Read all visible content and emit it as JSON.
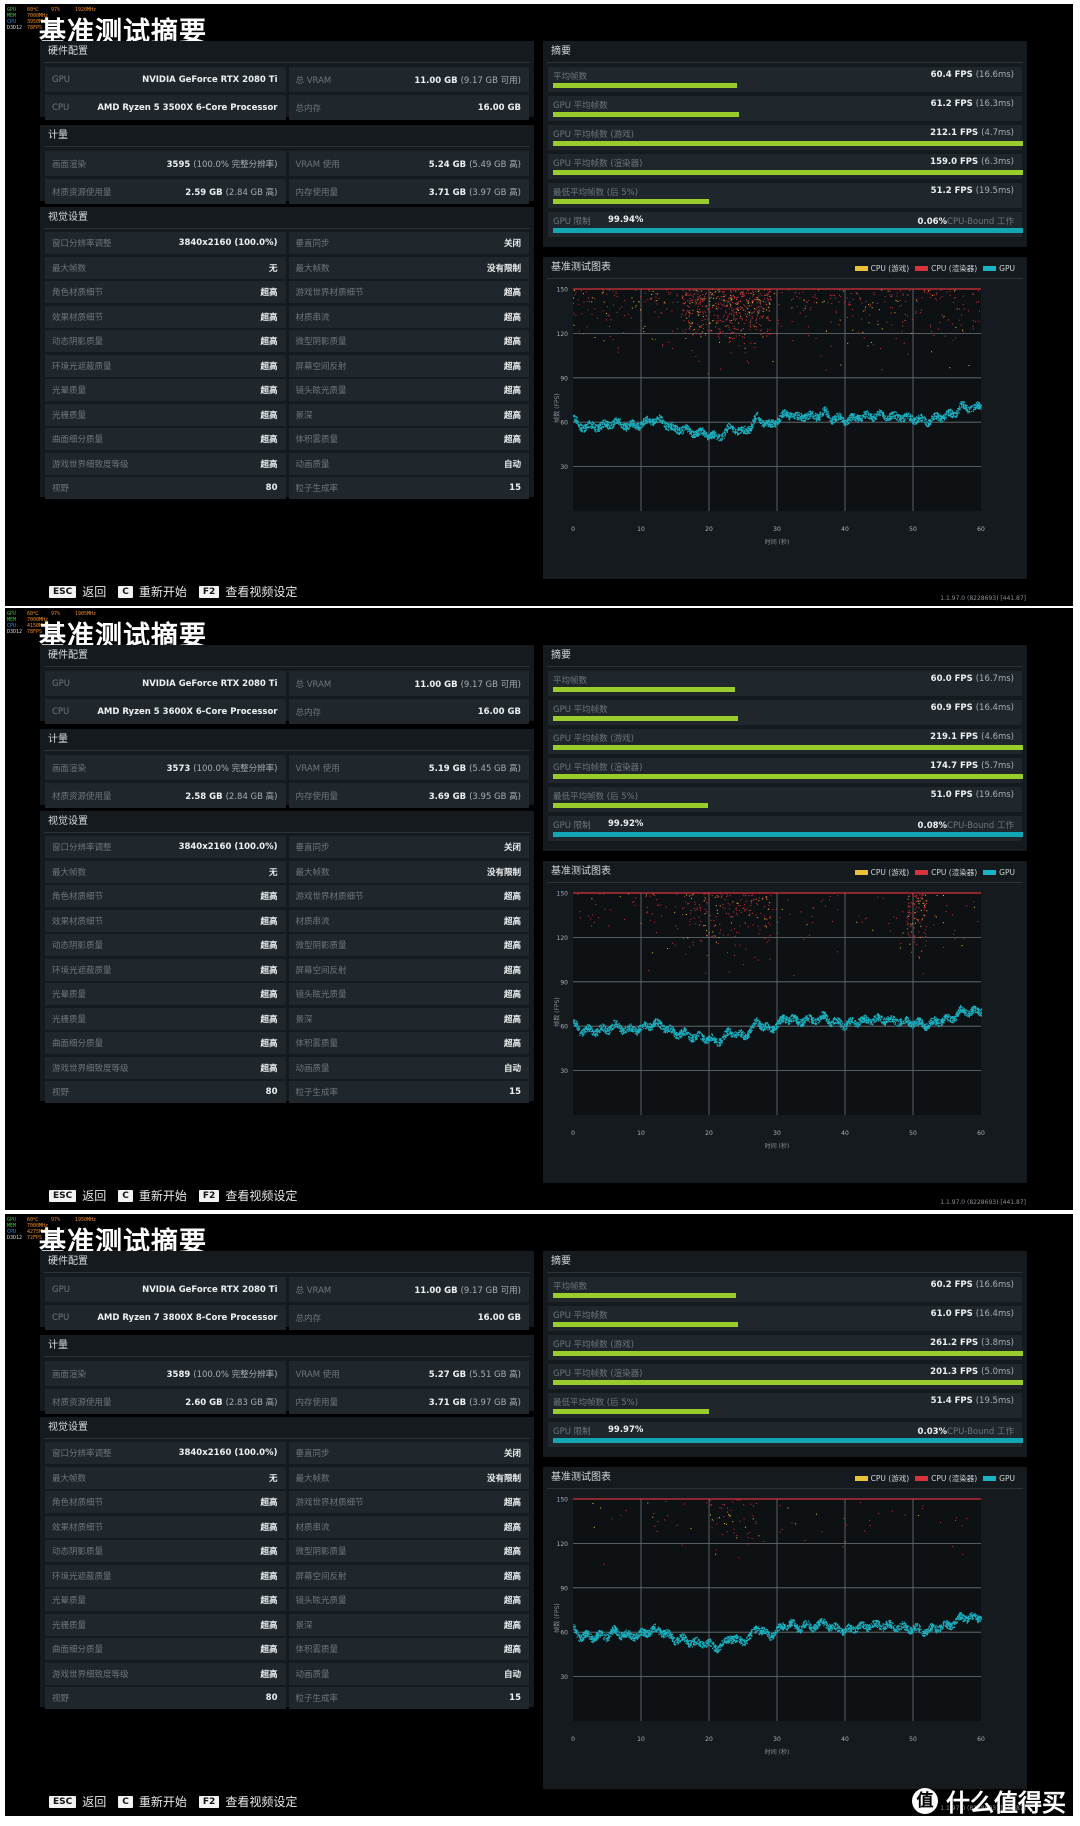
{
  "page_title": "基准测试摘要",
  "labels": {
    "hardware": "硬件配置",
    "metrics": "计量",
    "visual": "视觉设置",
    "summary": "摘要",
    "chart": "基准测试图表",
    "gpu": "GPU",
    "cpu": "CPU",
    "total_vram": "总 VRAM",
    "total_ram": "总内存",
    "render": "画面渲染",
    "vram_use": "VRAM 使用",
    "texture_use": "材质资源使用量",
    "ram_use": "内存使用量",
    "avg_fps": "平均帧数",
    "gpu_avg_fps": "GPU 平均帧数",
    "gpu_avg_fps_game": "GPU 平均帧数 (游戏)",
    "gpu_avg_fps_render": "GPU 平均帧数 (渲染器)",
    "low_fps": "最低平均帧数 (后 5%)",
    "gpu_bound": "GPU 限制",
    "cpu_bound": "CPU-Bound 工作"
  },
  "footer": [
    {
      "key": "ESC",
      "label": "返回"
    },
    {
      "key": "C",
      "label": "重新开始"
    },
    {
      "key": "F2",
      "label": "查看视频设定"
    }
  ],
  "visual_settings": [
    {
      "left_label": "窗口分辨率调整",
      "left_value": "3840x2160 (100.0%)",
      "right_label": "垂直同步",
      "right_value": "关闭"
    },
    {
      "left_label": "最大帧数",
      "left_value": "无",
      "right_label": "最大帧数",
      "right_value": "没有限制"
    },
    {
      "left_label": "角色材质细节",
      "left_value": "超高",
      "right_label": "游戏世界材质细节",
      "right_value": "超高"
    },
    {
      "left_label": "效果材质细节",
      "left_value": "超高",
      "right_label": "材质串流",
      "right_value": "超高"
    },
    {
      "left_label": "动态阴影质量",
      "left_value": "超高",
      "right_label": "微型阴影质量",
      "right_value": "超高"
    },
    {
      "left_label": "环境光遮蔽质量",
      "left_value": "超高",
      "right_label": "屏幕空间反射",
      "right_value": "超高"
    },
    {
      "left_label": "光晕质量",
      "left_value": "超高",
      "right_label": "镜头眩光质量",
      "right_value": "超高"
    },
    {
      "left_label": "光栅质量",
      "left_value": "超高",
      "right_label": "景深",
      "right_value": "超高"
    },
    {
      "left_label": "曲面细分质量",
      "left_value": "超高",
      "right_label": "体积雾质量",
      "right_value": "超高"
    },
    {
      "left_label": "游戏世界细致度等级",
      "left_value": "超高",
      "right_label": "动画质量",
      "right_value": "自动"
    },
    {
      "left_label": "视野",
      "left_value": "80",
      "right_label": "粒子生成率",
      "right_value": "15"
    }
  ],
  "version": "1.1.97.0 (8228693) [441.87]",
  "watermark": {
    "icon": "值",
    "text": "什么值得买"
  },
  "colors": {
    "green_bar": "#9acd2c",
    "teal_bar": "#12a6b4",
    "cpu_game": "#e8c23c",
    "cpu_render": "#d8323c",
    "gpu": "#1bb3c2"
  },
  "screens": [
    {
      "osd": [
        {
          "k": "GPU",
          "v": "60℃",
          "v2": "97%",
          "v3": "1920MHz"
        },
        {
          "k": "MEM",
          "v": "7000MHz"
        },
        {
          "k": "CPU",
          "v": "3950MHz"
        },
        {
          "k": "D3D12",
          "v": "78FPS"
        }
      ],
      "gpu_name": "NVIDIA GeForce RTX 2080 Ti",
      "cpu_name": "AMD Ryzen 5 3500X 6-Core Processor",
      "total_vram": "11.00 GB",
      "total_vram_sub": "(9.17 GB 可用)",
      "total_ram": "16.00 GB",
      "render": "3595",
      "render_sub": "(100.0% 完整分辨率)",
      "vram_use": "5.24 GB",
      "vram_use_sub": "(5.49 GB 高)",
      "texture_use": "2.59 GB",
      "texture_use_sub": "(2.84 GB 高)",
      "ram_use": "3.71 GB",
      "ram_use_sub": "(3.97 GB 高)",
      "summary": [
        {
          "label_key": "avg_fps",
          "value": "60.4 FPS",
          "sub": "(16.6ms)",
          "fps": 60.4
        },
        {
          "label_key": "gpu_avg_fps",
          "value": "61.2 FPS",
          "sub": "(16.3ms)",
          "fps": 61.2
        },
        {
          "label_key": "gpu_avg_fps_game",
          "value": "212.1 FPS",
          "sub": "(4.7ms)",
          "fps": 212.1
        },
        {
          "label_key": "gpu_avg_fps_render",
          "value": "159.0 FPS",
          "sub": "(6.3ms)",
          "fps": 159.0
        },
        {
          "label_key": "low_fps",
          "value": "51.2 FPS",
          "sub": "(19.5ms)",
          "fps": 51.2
        }
      ],
      "gpu_bound": "99.94%",
      "cpu_bound": "0.06%",
      "gpu_bound_frac": 0.9994,
      "cpu_density": 1.0
    },
    {
      "osd": [
        {
          "k": "GPU",
          "v": "60℃",
          "v2": "97%",
          "v3": "1905MHz"
        },
        {
          "k": "MEM",
          "v": "7000MHz"
        },
        {
          "k": "CPU",
          "v": "4150MHz"
        },
        {
          "k": "D3D12",
          "v": "78FPS"
        }
      ],
      "gpu_name": "NVIDIA GeForce RTX 2080 Ti",
      "cpu_name": "AMD Ryzen 5 3600X 6-Core Processor",
      "total_vram": "11.00 GB",
      "total_vram_sub": "(9.17 GB 可用)",
      "total_ram": "16.00 GB",
      "render": "3573",
      "render_sub": "(100.0% 完整分辨率)",
      "vram_use": "5.19 GB",
      "vram_use_sub": "(5.45 GB 高)",
      "texture_use": "2.58 GB",
      "texture_use_sub": "(2.84 GB 高)",
      "ram_use": "3.69 GB",
      "ram_use_sub": "(3.95 GB 高)",
      "summary": [
        {
          "label_key": "avg_fps",
          "value": "60.0 FPS",
          "sub": "(16.7ms)",
          "fps": 60.0
        },
        {
          "label_key": "gpu_avg_fps",
          "value": "60.9 FPS",
          "sub": "(16.4ms)",
          "fps": 60.9
        },
        {
          "label_key": "gpu_avg_fps_game",
          "value": "219.1 FPS",
          "sub": "(4.6ms)",
          "fps": 219.1
        },
        {
          "label_key": "gpu_avg_fps_render",
          "value": "174.7 FPS",
          "sub": "(5.7ms)",
          "fps": 174.7
        },
        {
          "label_key": "low_fps",
          "value": "51.0 FPS",
          "sub": "(19.6ms)",
          "fps": 51.0
        }
      ],
      "gpu_bound": "99.92%",
      "cpu_bound": "0.08%",
      "gpu_bound_frac": 0.9992,
      "cpu_density": 0.5
    },
    {
      "osd": [
        {
          "k": "GPU",
          "v": "60℃",
          "v2": "97%",
          "v3": "1950MHz"
        },
        {
          "k": "MEM",
          "v": "7000MHz"
        },
        {
          "k": "CPU",
          "v": "4275MHz"
        },
        {
          "k": "D3D12",
          "v": "72FPS"
        }
      ],
      "gpu_name": "NVIDIA GeForce RTX 2080 Ti",
      "cpu_name": "AMD Ryzen 7 3800X 8-Core Processor",
      "total_vram": "11.00 GB",
      "total_vram_sub": "(9.17 GB 可用)",
      "total_ram": "16.00 GB",
      "render": "3589",
      "render_sub": "(100.0% 完整分辨率)",
      "vram_use": "5.27 GB",
      "vram_use_sub": "(5.51 GB 高)",
      "texture_use": "2.60 GB",
      "texture_use_sub": "(2.83 GB 高)",
      "ram_use": "3.71 GB",
      "ram_use_sub": "(3.97 GB 高)",
      "summary": [
        {
          "label_key": "avg_fps",
          "value": "60.2 FPS",
          "sub": "(16.6ms)",
          "fps": 60.2
        },
        {
          "label_key": "gpu_avg_fps",
          "value": "61.0 FPS",
          "sub": "(16.4ms)",
          "fps": 61.0
        },
        {
          "label_key": "gpu_avg_fps_game",
          "value": "261.2 FPS",
          "sub": "(3.8ms)",
          "fps": 261.2
        },
        {
          "label_key": "gpu_avg_fps_render",
          "value": "201.3 FPS",
          "sub": "(5.0ms)",
          "fps": 201.3
        },
        {
          "label_key": "low_fps",
          "value": "51.4 FPS",
          "sub": "(19.5ms)",
          "fps": 51.4
        }
      ],
      "gpu_bound": "99.97%",
      "cpu_bound": "0.03%",
      "gpu_bound_frac": 0.9997,
      "cpu_density": 0.12
    }
  ],
  "summary_bar_max_fps": 150,
  "chart_data": {
    "type": "scatter",
    "title": "基准测试图表",
    "xlabel": "时间 (秒)",
    "ylabel": "帧数 (FPS)",
    "xlim": [
      0,
      60
    ],
    "ylim": [
      0,
      150
    ],
    "xticks": [
      "0",
      "10",
      "20",
      "30",
      "40",
      "50",
      "60"
    ],
    "yticks": [
      "30",
      "60",
      "90",
      "120",
      "150"
    ],
    "grid": true,
    "legend_position": "top-right",
    "legend": [
      "CPU (游戏)",
      "CPU (渲染器)",
      "GPU"
    ],
    "cap_line_fps": 150,
    "gpu_trend": {
      "x": [
        0,
        1,
        2,
        3,
        4,
        5,
        6,
        7,
        8,
        9,
        10,
        11,
        12,
        13,
        14,
        15,
        16,
        17,
        18,
        19,
        20,
        21,
        22,
        23,
        24,
        25,
        26,
        27,
        28,
        29,
        30,
        31,
        32,
        33,
        34,
        35,
        36,
        37,
        38,
        39,
        40,
        41,
        42,
        43,
        44,
        45,
        46,
        47,
        48,
        49,
        50,
        51,
        52,
        53,
        54,
        55,
        56,
        57,
        58,
        59,
        60
      ],
      "y": [
        63,
        57,
        58,
        57,
        58,
        58,
        61,
        59,
        58,
        58,
        59,
        61,
        62,
        61,
        58,
        55,
        56,
        54,
        53,
        53,
        52,
        50,
        52,
        57,
        55,
        54,
        57,
        64,
        60,
        58,
        62,
        65,
        66,
        63,
        65,
        64,
        65,
        67,
        63,
        63,
        61,
        63,
        64,
        64,
        65,
        65,
        65,
        64,
        64,
        63,
        63,
        62,
        61,
        63,
        64,
        65,
        66,
        71,
        70,
        70,
        71
      ]
    },
    "cpu_scatter_range": [
      90,
      150
    ]
  }
}
